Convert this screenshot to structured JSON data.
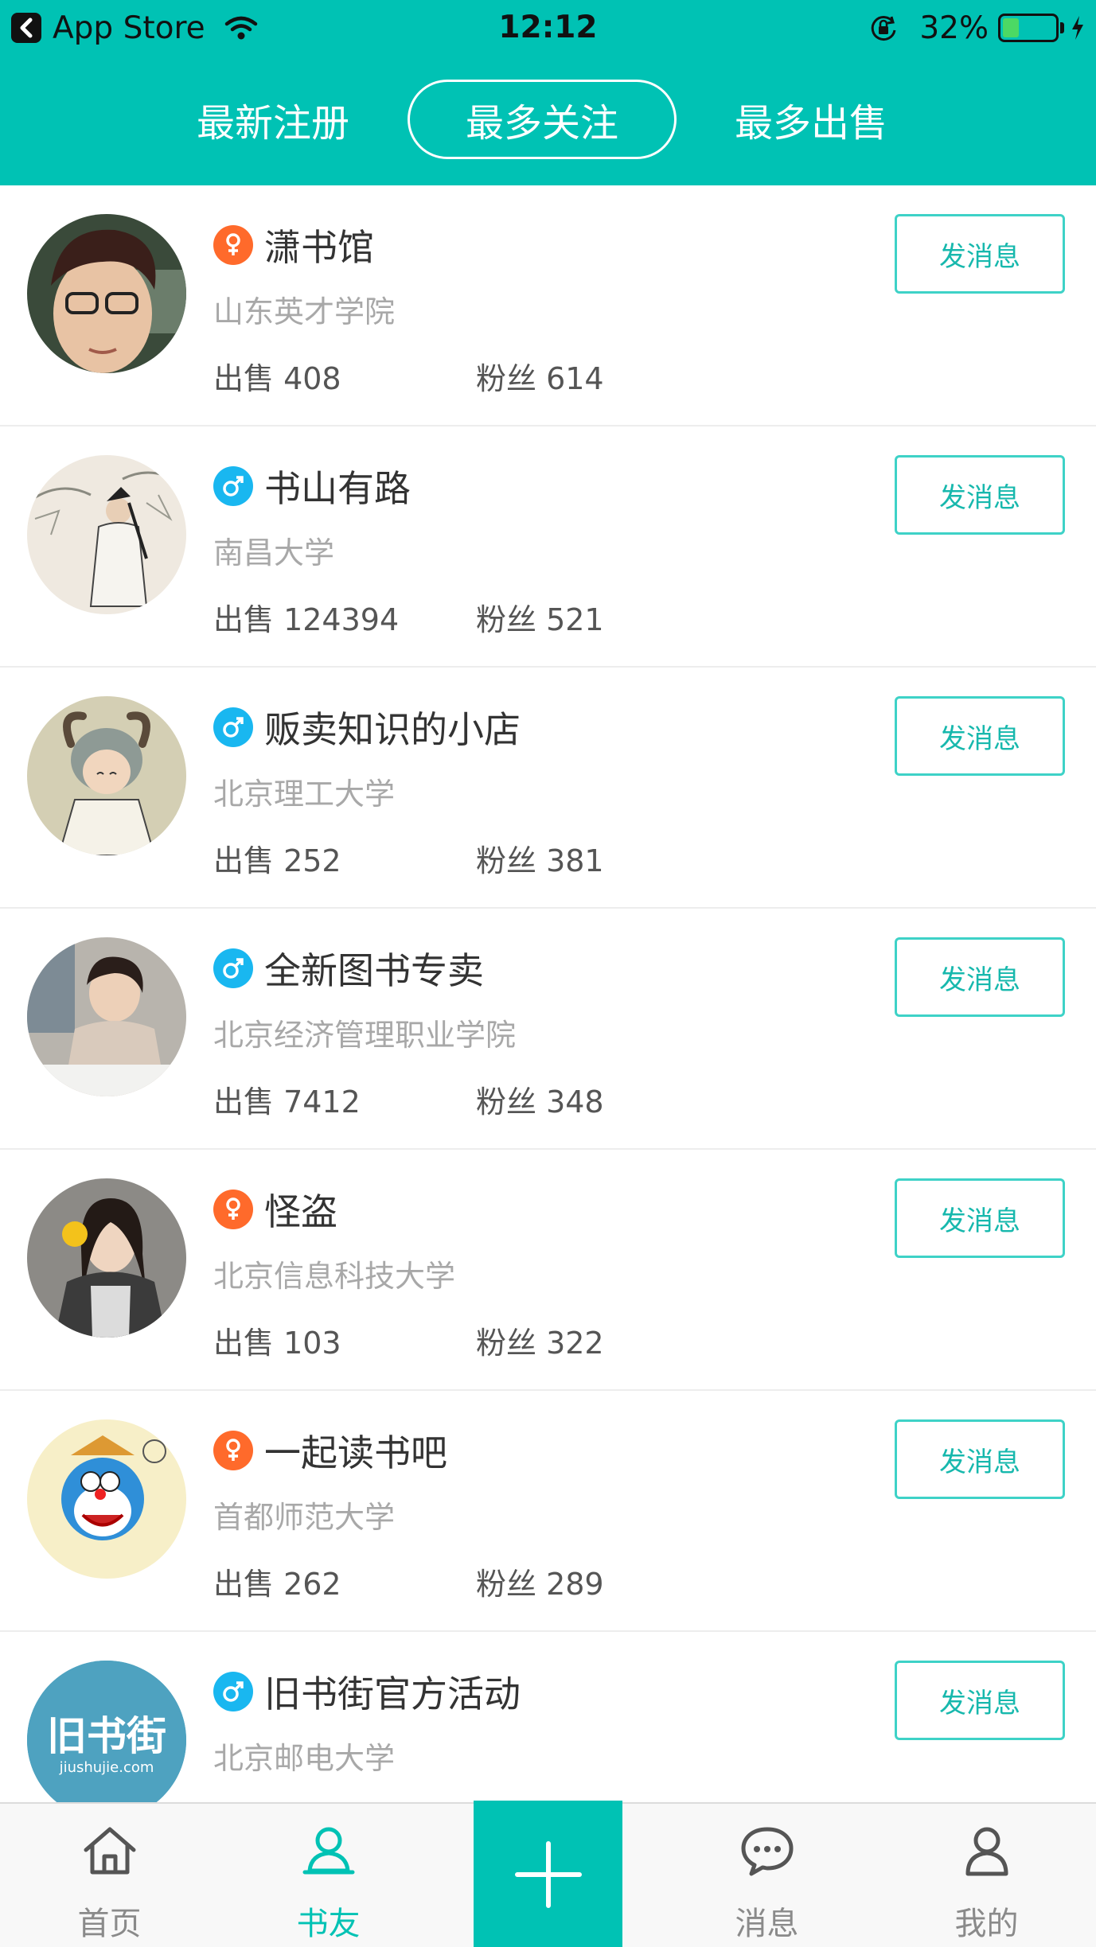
{
  "status_bar": {
    "back_app": "App Store",
    "time": "12:12",
    "battery": "32%",
    "battery_level": 0.32
  },
  "tabs": [
    {
      "label": "最新注册",
      "active": false
    },
    {
      "label": "最多关注",
      "active": true
    },
    {
      "label": "最多出售",
      "active": false
    }
  ],
  "users": [
    {
      "gender": "female",
      "gender_symbol": "♀",
      "name": "潇书馆",
      "school": "山东英才学院",
      "sold": "出售 408",
      "fans": "粉丝 614",
      "button": "发消息"
    },
    {
      "gender": "male",
      "gender_symbol": "♂",
      "name": "书山有路",
      "school": "南昌大学",
      "sold": "出售 124394",
      "fans": "粉丝 521",
      "button": "发消息"
    },
    {
      "gender": "male",
      "gender_symbol": "♂",
      "name": "贩卖知识的小店",
      "school": "北京理工大学",
      "sold": "出售 252",
      "fans": "粉丝 381",
      "button": "发消息"
    },
    {
      "gender": "male",
      "gender_symbol": "♂",
      "name": "全新图书专卖",
      "school": "北京经济管理职业学院",
      "sold": "出售 7412",
      "fans": "粉丝 348",
      "button": "发消息"
    },
    {
      "gender": "female",
      "gender_symbol": "♀",
      "name": "怪盗",
      "school": "北京信息科技大学",
      "sold": "出售 103",
      "fans": "粉丝 322",
      "button": "发消息"
    },
    {
      "gender": "female",
      "gender_symbol": "♀",
      "name": "一起读书吧",
      "school": "首都师范大学",
      "sold": "出售 262",
      "fans": "粉丝 289",
      "button": "发消息"
    },
    {
      "gender": "male",
      "gender_symbol": "♂",
      "name": "旧书街官方活动",
      "school": "北京邮电大学",
      "sold": "",
      "fans": "",
      "button": "发消息",
      "logo_text": "旧书街",
      "logo_sub": "jiushujie.com"
    }
  ],
  "nav": {
    "home": "首页",
    "friends": "书友",
    "messages": "消息",
    "me": "我的",
    "active": "friends"
  },
  "colors": {
    "brand": "#00c2b4",
    "female": "#ff6a2b",
    "male": "#19b7f0"
  },
  "icons": [
    "back-icon",
    "wifi-icon",
    "rotation-lock-icon",
    "battery-icon",
    "charging-bolt-icon",
    "home-icon",
    "friends-icon",
    "plus-icon",
    "chat-icon",
    "user-icon"
  ]
}
